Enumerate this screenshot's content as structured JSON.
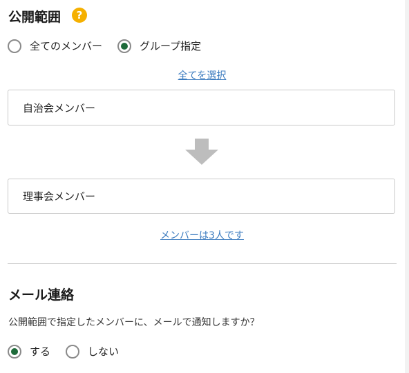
{
  "visibility": {
    "title": "公開範囲",
    "help_icon": "?",
    "options": [
      {
        "label": "全てのメンバー",
        "selected": false
      },
      {
        "label": "グループ指定",
        "selected": true
      }
    ],
    "select_all_link": "全てを選択",
    "source_group": "自治会メンバー",
    "arrow_icon": "arrow-down-icon",
    "target_group": "理事会メンバー",
    "member_count_link": "メンバーは3人です"
  },
  "mail": {
    "title": "メール連絡",
    "description": "公開範囲で指定したメンバーに、メールで通知しますか？",
    "options": [
      {
        "label": "する",
        "selected": true
      },
      {
        "label": "しない",
        "selected": false
      }
    ]
  },
  "colors": {
    "accent_green": "#1e6b3a",
    "link_blue": "#3b7bbf",
    "help_yellow": "#f5b000",
    "arrow_gray": "#bdbdbd"
  }
}
